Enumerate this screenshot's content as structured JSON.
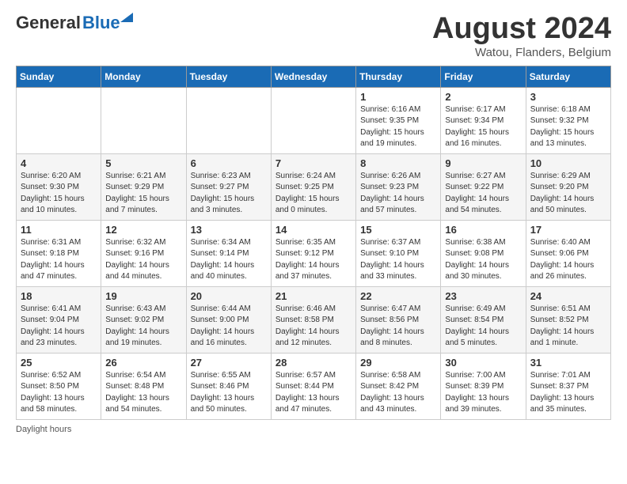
{
  "header": {
    "logo_general": "General",
    "logo_blue": "Blue",
    "month_year": "August 2024",
    "location": "Watou, Flanders, Belgium"
  },
  "days_of_week": [
    "Sunday",
    "Monday",
    "Tuesday",
    "Wednesday",
    "Thursday",
    "Friday",
    "Saturday"
  ],
  "weeks": [
    [
      {
        "day": "",
        "info": ""
      },
      {
        "day": "",
        "info": ""
      },
      {
        "day": "",
        "info": ""
      },
      {
        "day": "",
        "info": ""
      },
      {
        "day": "1",
        "info": "Sunrise: 6:16 AM\nSunset: 9:35 PM\nDaylight: 15 hours\nand 19 minutes."
      },
      {
        "day": "2",
        "info": "Sunrise: 6:17 AM\nSunset: 9:34 PM\nDaylight: 15 hours\nand 16 minutes."
      },
      {
        "day": "3",
        "info": "Sunrise: 6:18 AM\nSunset: 9:32 PM\nDaylight: 15 hours\nand 13 minutes."
      }
    ],
    [
      {
        "day": "4",
        "info": "Sunrise: 6:20 AM\nSunset: 9:30 PM\nDaylight: 15 hours\nand 10 minutes."
      },
      {
        "day": "5",
        "info": "Sunrise: 6:21 AM\nSunset: 9:29 PM\nDaylight: 15 hours\nand 7 minutes."
      },
      {
        "day": "6",
        "info": "Sunrise: 6:23 AM\nSunset: 9:27 PM\nDaylight: 15 hours\nand 3 minutes."
      },
      {
        "day": "7",
        "info": "Sunrise: 6:24 AM\nSunset: 9:25 PM\nDaylight: 15 hours\nand 0 minutes."
      },
      {
        "day": "8",
        "info": "Sunrise: 6:26 AM\nSunset: 9:23 PM\nDaylight: 14 hours\nand 57 minutes."
      },
      {
        "day": "9",
        "info": "Sunrise: 6:27 AM\nSunset: 9:22 PM\nDaylight: 14 hours\nand 54 minutes."
      },
      {
        "day": "10",
        "info": "Sunrise: 6:29 AM\nSunset: 9:20 PM\nDaylight: 14 hours\nand 50 minutes."
      }
    ],
    [
      {
        "day": "11",
        "info": "Sunrise: 6:31 AM\nSunset: 9:18 PM\nDaylight: 14 hours\nand 47 minutes."
      },
      {
        "day": "12",
        "info": "Sunrise: 6:32 AM\nSunset: 9:16 PM\nDaylight: 14 hours\nand 44 minutes."
      },
      {
        "day": "13",
        "info": "Sunrise: 6:34 AM\nSunset: 9:14 PM\nDaylight: 14 hours\nand 40 minutes."
      },
      {
        "day": "14",
        "info": "Sunrise: 6:35 AM\nSunset: 9:12 PM\nDaylight: 14 hours\nand 37 minutes."
      },
      {
        "day": "15",
        "info": "Sunrise: 6:37 AM\nSunset: 9:10 PM\nDaylight: 14 hours\nand 33 minutes."
      },
      {
        "day": "16",
        "info": "Sunrise: 6:38 AM\nSunset: 9:08 PM\nDaylight: 14 hours\nand 30 minutes."
      },
      {
        "day": "17",
        "info": "Sunrise: 6:40 AM\nSunset: 9:06 PM\nDaylight: 14 hours\nand 26 minutes."
      }
    ],
    [
      {
        "day": "18",
        "info": "Sunrise: 6:41 AM\nSunset: 9:04 PM\nDaylight: 14 hours\nand 23 minutes."
      },
      {
        "day": "19",
        "info": "Sunrise: 6:43 AM\nSunset: 9:02 PM\nDaylight: 14 hours\nand 19 minutes."
      },
      {
        "day": "20",
        "info": "Sunrise: 6:44 AM\nSunset: 9:00 PM\nDaylight: 14 hours\nand 16 minutes."
      },
      {
        "day": "21",
        "info": "Sunrise: 6:46 AM\nSunset: 8:58 PM\nDaylight: 14 hours\nand 12 minutes."
      },
      {
        "day": "22",
        "info": "Sunrise: 6:47 AM\nSunset: 8:56 PM\nDaylight: 14 hours\nand 8 minutes."
      },
      {
        "day": "23",
        "info": "Sunrise: 6:49 AM\nSunset: 8:54 PM\nDaylight: 14 hours\nand 5 minutes."
      },
      {
        "day": "24",
        "info": "Sunrise: 6:51 AM\nSunset: 8:52 PM\nDaylight: 14 hours\nand 1 minute."
      }
    ],
    [
      {
        "day": "25",
        "info": "Sunrise: 6:52 AM\nSunset: 8:50 PM\nDaylight: 13 hours\nand 58 minutes."
      },
      {
        "day": "26",
        "info": "Sunrise: 6:54 AM\nSunset: 8:48 PM\nDaylight: 13 hours\nand 54 minutes."
      },
      {
        "day": "27",
        "info": "Sunrise: 6:55 AM\nSunset: 8:46 PM\nDaylight: 13 hours\nand 50 minutes."
      },
      {
        "day": "28",
        "info": "Sunrise: 6:57 AM\nSunset: 8:44 PM\nDaylight: 13 hours\nand 47 minutes."
      },
      {
        "day": "29",
        "info": "Sunrise: 6:58 AM\nSunset: 8:42 PM\nDaylight: 13 hours\nand 43 minutes."
      },
      {
        "day": "30",
        "info": "Sunrise: 7:00 AM\nSunset: 8:39 PM\nDaylight: 13 hours\nand 39 minutes."
      },
      {
        "day": "31",
        "info": "Sunrise: 7:01 AM\nSunset: 8:37 PM\nDaylight: 13 hours\nand 35 minutes."
      }
    ]
  ],
  "footer": {
    "daylight_label": "Daylight hours"
  }
}
